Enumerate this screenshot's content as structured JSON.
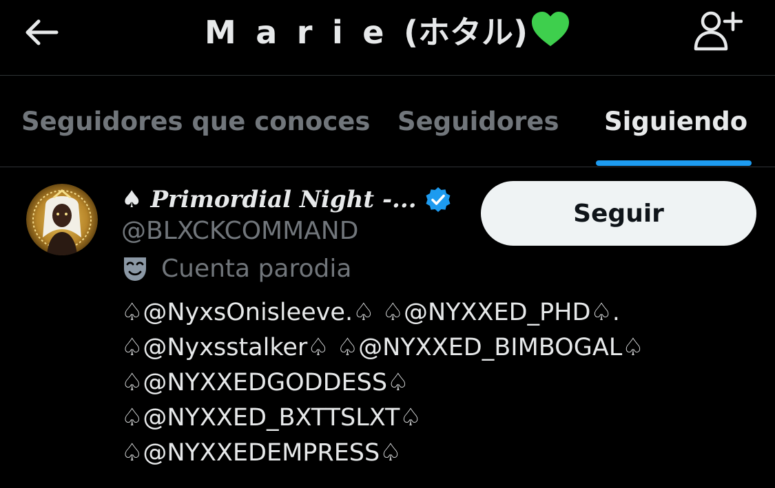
{
  "header": {
    "title_spaced": "Marie",
    "title_rest": "(ホタル)",
    "title_emoji": "💚",
    "back_icon": "arrow-left-icon",
    "add_user_icon": "add-user-icon"
  },
  "tabs": [
    {
      "label": "Seguidores que conoces",
      "active": false
    },
    {
      "label": "Seguidores",
      "active": false
    },
    {
      "label": "Siguiendo",
      "active": true
    }
  ],
  "user": {
    "name_prefix": "♠",
    "display_name": "Primordial Night -...",
    "verified_icon": "verified-badge-icon",
    "handle": "@BLXCKCOMMAND",
    "parody_icon": "theater-mask-icon",
    "parody_label": "Cuenta parodia",
    "follow_label": "Seguir",
    "bio_lines": [
      "♤@NyxsOnisleeve.♤ ♤@NYXXED_PHD♤.",
      "♤@Nyxsstalker♤ ♤@NYXXED_BIMBOGAL♤",
      "♤@NYXXEDGODDESS♤",
      "♤@NYXXED_BXTTSLXT♤",
      "♤@NYXXEDEMPRESS♤"
    ]
  },
  "colors": {
    "background": "#000000",
    "primary_text": "#e7e9ea",
    "secondary_text": "#71767b",
    "accent": "#1d9bf0",
    "heart": "#3ecf4d",
    "follow_button_bg": "#eff3f4"
  }
}
